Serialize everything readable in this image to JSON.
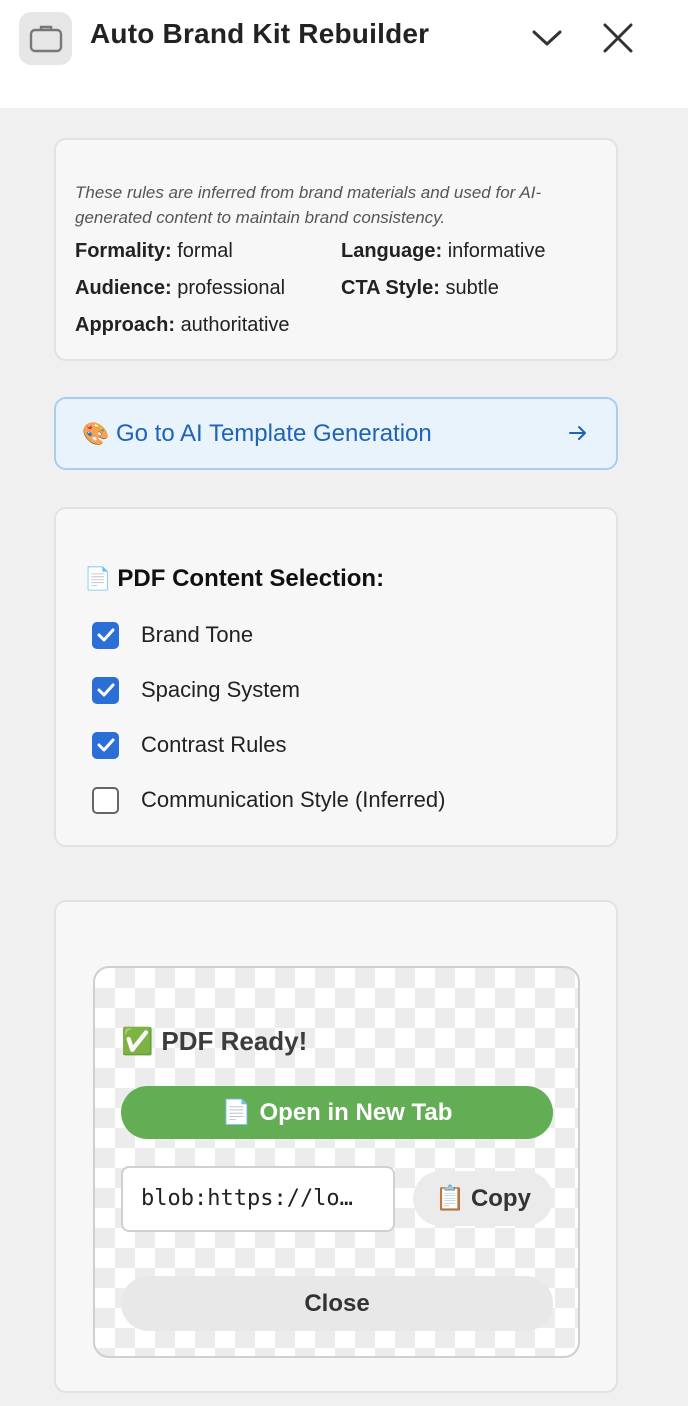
{
  "header": {
    "title": "Auto Brand Kit Rebuilder",
    "app_icon": "briefcase-icon",
    "collapse_icon": "chevron-down-icon",
    "close_icon": "close-icon"
  },
  "tone_card": {
    "note": "These rules are inferred from brand materials and used for AI-generated content to maintain brand consistency.",
    "items": [
      {
        "label": "Formality:",
        "value": "formal"
      },
      {
        "label": "Language:",
        "value": "informative"
      },
      {
        "label": "Audience:",
        "value": "professional"
      },
      {
        "label": "CTA Style:",
        "value": "subtle"
      },
      {
        "label": "Approach:",
        "value": "authoritative"
      }
    ]
  },
  "ai_link": {
    "emoji": "🎨",
    "label": "Go to AI Template Generation",
    "arrow": "→"
  },
  "pdf_selection": {
    "title_icon": "📄",
    "title": "PDF Content Selection:",
    "options": [
      {
        "label": "Brand Tone",
        "checked": true
      },
      {
        "label": "Spacing System",
        "checked": true
      },
      {
        "label": "Contrast Rules",
        "checked": true
      },
      {
        "label": "Communication Style (Inferred)",
        "checked": false
      }
    ]
  },
  "result": {
    "ready_icon": "✅",
    "ready_text": "PDF Ready!",
    "open_icon": "📄",
    "open_label": "Open in New Tab",
    "url_value": "blob:https://lo…",
    "copy_icon": "📋",
    "copy_label": "Copy",
    "close_label": "Close"
  },
  "colors": {
    "accent_blue": "#2b6fd6",
    "link_blue": "#1f63b8",
    "success_green": "#63ad55"
  }
}
